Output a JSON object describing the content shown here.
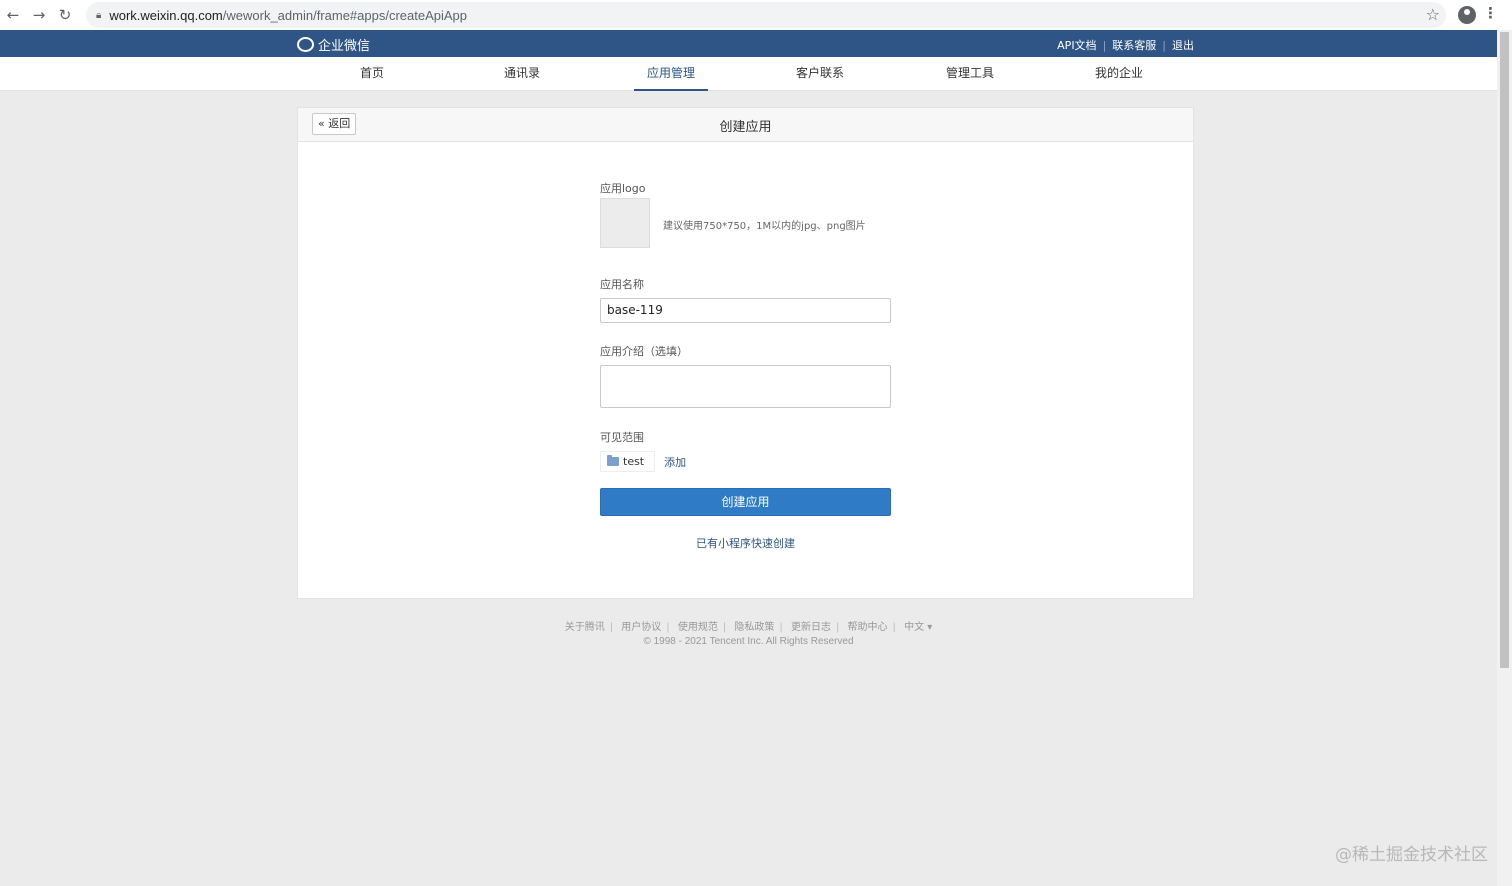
{
  "browser": {
    "url_host": "work.weixin.qq.com",
    "url_path": "/wework_admin/frame#apps/createApiApp"
  },
  "header": {
    "brand": "企业微信",
    "links": [
      "API文档",
      "联系客服",
      "退出"
    ],
    "separator": "|"
  },
  "nav": {
    "items": [
      {
        "label": "首页",
        "active": false
      },
      {
        "label": "通讯录",
        "active": false
      },
      {
        "label": "应用管理",
        "active": true
      },
      {
        "label": "客户联系",
        "active": false
      },
      {
        "label": "管理工具",
        "active": false
      },
      {
        "label": "我的企业",
        "active": false
      }
    ]
  },
  "card": {
    "back_label": "« 返回",
    "title": "创建应用"
  },
  "form": {
    "logo_label": "应用logo",
    "logo_hint": "建议使用750*750，1M以内的jpg、png图片",
    "name_label": "应用名称",
    "name_value": "base-119",
    "intro_label": "应用介绍（选填）",
    "intro_value": "",
    "scope_label": "可见范围",
    "scope_tag": "test",
    "add_label": "添加",
    "create_label": "创建应用",
    "mini_program_link": "已有小程序快速创建"
  },
  "footer": {
    "links": [
      "关于腾讯",
      "用户协议",
      "使用规范",
      "隐私政策",
      "更新日志",
      "帮助中心",
      "中文 ▾"
    ],
    "separator": "|",
    "copyright": "© 1998 - 2021 Tencent Inc. All Rights Reserved"
  },
  "watermark": "@稀土掘金技术社区",
  "colors": {
    "header_bg": "#2e5585",
    "primary_button": "#2f7bc6",
    "link": "#2e5585"
  }
}
